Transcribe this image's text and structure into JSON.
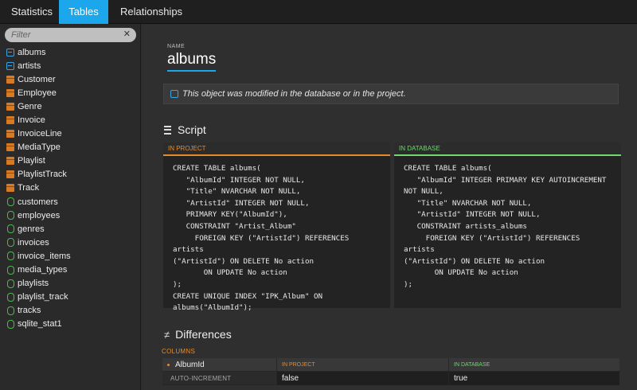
{
  "tabs": [
    {
      "label": "Statistics",
      "active": false
    },
    {
      "label": "Tables",
      "active": true
    },
    {
      "label": "Relationships",
      "active": false
    }
  ],
  "sidebar": {
    "filter_placeholder": "Filter",
    "clear_glyph": "✕",
    "items": [
      {
        "label": "albums",
        "kind": "view"
      },
      {
        "label": "artists",
        "kind": "view"
      },
      {
        "label": "Customer",
        "kind": "table"
      },
      {
        "label": "Employee",
        "kind": "table"
      },
      {
        "label": "Genre",
        "kind": "table"
      },
      {
        "label": "Invoice",
        "kind": "table"
      },
      {
        "label": "InvoiceLine",
        "kind": "table"
      },
      {
        "label": "MediaType",
        "kind": "table"
      },
      {
        "label": "Playlist",
        "kind": "table"
      },
      {
        "label": "PlaylistTrack",
        "kind": "table"
      },
      {
        "label": "Track",
        "kind": "table"
      },
      {
        "label": "customers",
        "kind": "index"
      },
      {
        "label": "employees",
        "kind": "index"
      },
      {
        "label": "genres",
        "kind": "index"
      },
      {
        "label": "invoices",
        "kind": "index"
      },
      {
        "label": "invoice_items",
        "kind": "index"
      },
      {
        "label": "media_types",
        "kind": "index"
      },
      {
        "label": "playlists",
        "kind": "index"
      },
      {
        "label": "playlist_track",
        "kind": "index"
      },
      {
        "label": "tracks",
        "kind": "index"
      },
      {
        "label": "sqlite_stat1",
        "kind": "index"
      }
    ]
  },
  "main": {
    "name_label": "NAME",
    "name_value": "albums",
    "notice": "This object was modified in the database or in the project.",
    "script_title": "Script",
    "in_project_label": "IN PROJECT",
    "in_database_label": "IN DATABASE",
    "project_script": "CREATE TABLE albums(\n   \"AlbumId\" INTEGER NOT NULL,\n   \"Title\" NVARCHAR NOT NULL,\n   \"ArtistId\" INTEGER NOT NULL,\n   PRIMARY KEY(\"AlbumId\"),\n   CONSTRAINT \"Artist_Album\"\n     FOREIGN KEY (\"ArtistId\") REFERENCES artists\n(\"ArtistId\") ON DELETE No action\n       ON UPDATE No action\n);\nCREATE UNIQUE INDEX \"IPK_Album\" ON\nalbums(\"AlbumId\");",
    "database_script": "CREATE TABLE albums(\n   \"AlbumId\" INTEGER PRIMARY KEY AUTOINCREMENT\nNOT NULL,\n   \"Title\" NVARCHAR NOT NULL,\n   \"ArtistId\" INTEGER NOT NULL,\n   CONSTRAINT artists_albums\n     FOREIGN KEY (\"ArtistId\") REFERENCES artists\n(\"ArtistId\") ON DELETE No action\n       ON UPDATE No action\n);",
    "differences_title": "Differences",
    "columns_label": "COLUMNS",
    "diff": {
      "column_name": "AlbumId",
      "in_project_label": "IN PROJECT",
      "in_database_label": "IN DATABASE",
      "property": "AUTO-INCREMENT",
      "project_value": "false",
      "database_value": "true"
    }
  },
  "colors": {
    "accent": "#1ca6ec",
    "project": "#e98a2a",
    "database": "#6fd86f"
  }
}
